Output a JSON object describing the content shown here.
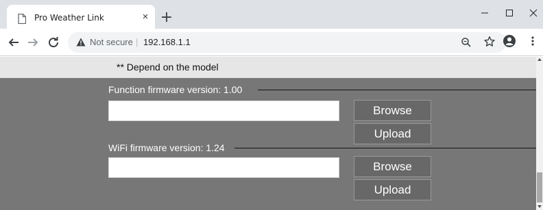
{
  "browser": {
    "tab_title": "Pro Weather Link",
    "tab_close_glyph": "×",
    "new_tab_glyph": "+",
    "security_label": "Not secure",
    "separator": "|",
    "url": "192.168.1.1",
    "icons": [
      "page-icon",
      "close-icon",
      "plus-icon",
      "minimize-icon",
      "maximize-icon",
      "close-window-icon",
      "back-arrow-icon",
      "forward-arrow-icon",
      "reload-icon",
      "warning-icon",
      "zoom-icon",
      "star-icon",
      "account-icon",
      "menu-icon"
    ]
  },
  "page": {
    "note": "** Depend on the model",
    "sections": [
      {
        "label": "Function firmware version: 1.00",
        "input_value": "",
        "browse_label": "Browse",
        "upload_label": "Upload"
      },
      {
        "label": "WiFi firmware version: 1.24",
        "input_value": "",
        "browse_label": "Browse",
        "upload_label": "Upload"
      }
    ]
  },
  "colors": {
    "panel": "#777777",
    "note_strip": "#e6e6e6",
    "button": "#686868",
    "tabbar": "#dee1e6"
  }
}
